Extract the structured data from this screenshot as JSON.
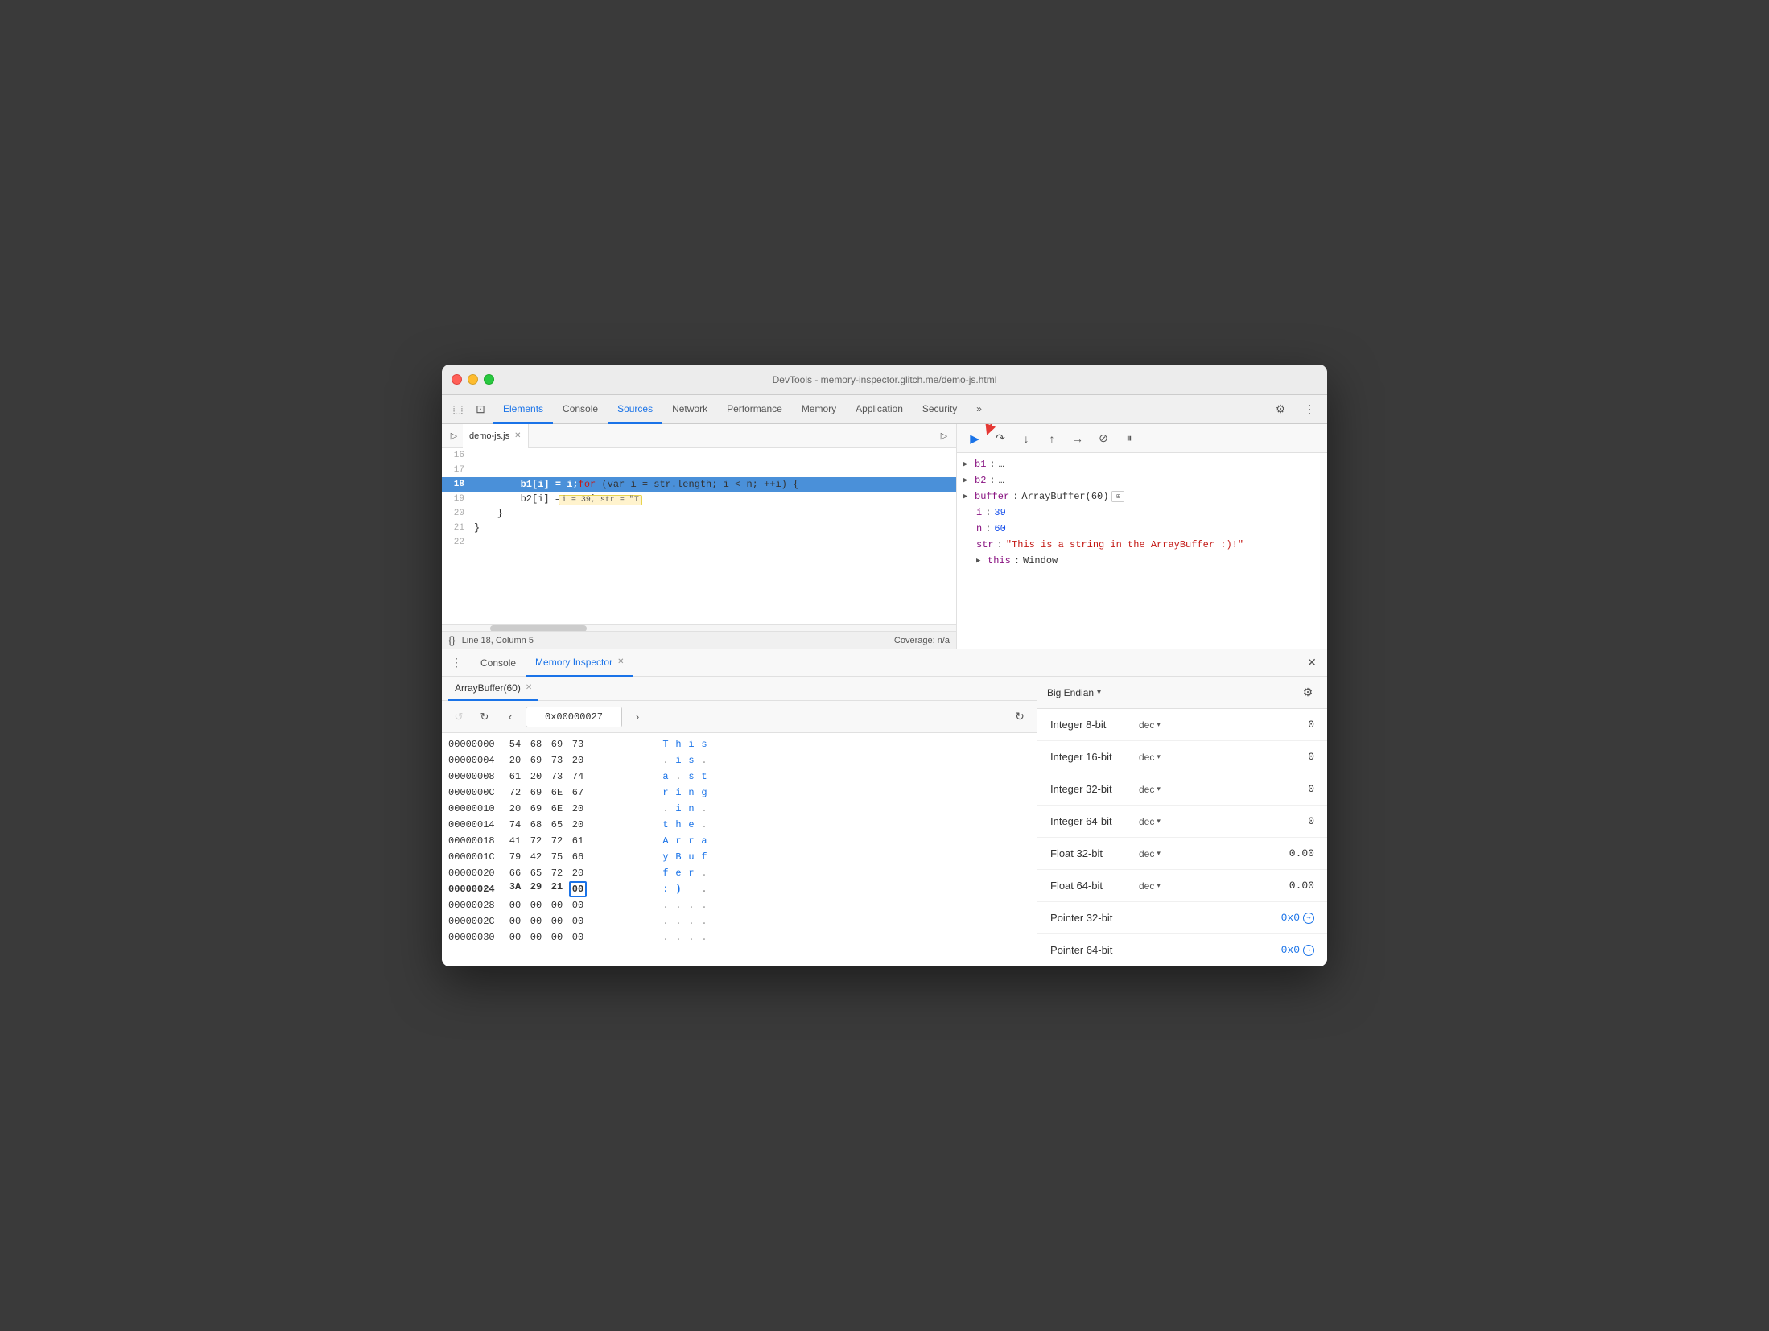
{
  "window": {
    "title": "DevTools - memory-inspector.glitch.me/demo-js.html"
  },
  "devtools_tabs": {
    "items": [
      {
        "id": "elements",
        "label": "Elements",
        "active": false
      },
      {
        "id": "console",
        "label": "Console",
        "active": false
      },
      {
        "id": "sources",
        "label": "Sources",
        "active": true
      },
      {
        "id": "network",
        "label": "Network",
        "active": false
      },
      {
        "id": "performance",
        "label": "Performance",
        "active": false
      },
      {
        "id": "memory",
        "label": "Memory",
        "active": false
      },
      {
        "id": "application",
        "label": "Application",
        "active": false
      },
      {
        "id": "security",
        "label": "Security",
        "active": false
      }
    ]
  },
  "file_tab": {
    "name": "demo-js.js",
    "show_close": true
  },
  "code": {
    "lines": [
      {
        "num": "16",
        "content": ""
      },
      {
        "num": "17",
        "content": "    for (var i = str.length; i < n; ++i) {   i = 39, str = \"T",
        "annotation": "  i = 39, str = \"T"
      },
      {
        "num": "18",
        "content": "        b1[i] = i;",
        "highlighted": true
      },
      {
        "num": "19",
        "content": "        b2[i] = n - i - 1;"
      },
      {
        "num": "20",
        "content": "    }"
      },
      {
        "num": "21",
        "content": "}"
      },
      {
        "num": "22",
        "content": ""
      }
    ],
    "status": {
      "line_col": "Line 18, Column 5",
      "coverage": "Coverage: n/a"
    }
  },
  "debug_panel": {
    "variables": [
      {
        "name": "b1",
        "value": "…",
        "has_arrow": true
      },
      {
        "name": "b2",
        "value": "…",
        "has_arrow": true
      },
      {
        "name": "buffer",
        "value": "ArrayBuffer(60)",
        "has_memory_icon": true,
        "has_arrow": true
      },
      {
        "name": "i",
        "value": "39",
        "is_number": true,
        "indent": true
      },
      {
        "name": "n",
        "value": "60",
        "is_number": true,
        "indent": true
      },
      {
        "name": "str",
        "value": "\"This is a string in the ArrayBuffer :)!\"",
        "is_string": true,
        "indent": true
      },
      {
        "name": "this",
        "value": "Window",
        "has_arrow": true,
        "indent": true
      }
    ]
  },
  "bottom_panel": {
    "tabs": [
      {
        "id": "console",
        "label": "Console",
        "active": false
      },
      {
        "id": "memory-inspector",
        "label": "Memory Inspector",
        "active": true,
        "closeable": true
      }
    ]
  },
  "memory_buffer_tab": {
    "name": "ArrayBuffer(60)",
    "closeable": true
  },
  "memory_toolbar": {
    "address": "0x00000027",
    "back_disabled": true,
    "forward_disabled": false
  },
  "endian": {
    "label": "Big Endian"
  },
  "hex_rows": [
    {
      "addr": "00000000",
      "bytes": [
        "54",
        "68",
        "69",
        "73"
      ],
      "chars": [
        "T",
        "h",
        "i",
        "s"
      ],
      "chars_dot": [
        false,
        false,
        false,
        false
      ]
    },
    {
      "addr": "00000004",
      "bytes": [
        "20",
        "69",
        "73",
        "20"
      ],
      "chars": [
        " ",
        "i",
        "s",
        " "
      ],
      "chars_dot": [
        true,
        false,
        false,
        true
      ]
    },
    {
      "addr": "00000008",
      "bytes": [
        "61",
        "20",
        "73",
        "74"
      ],
      "chars": [
        "a",
        " ",
        "s",
        "t"
      ],
      "chars_dot": [
        false,
        true,
        false,
        false
      ]
    },
    {
      "addr": "0000000C",
      "bytes": [
        "72",
        "69",
        "6E",
        "67"
      ],
      "chars": [
        "r",
        "i",
        "n",
        "g"
      ],
      "chars_dot": [
        false,
        false,
        false,
        false
      ]
    },
    {
      "addr": "00000010",
      "bytes": [
        "20",
        "69",
        "6E",
        "20"
      ],
      "chars": [
        " ",
        "i",
        "n",
        " "
      ],
      "chars_dot": [
        true,
        false,
        false,
        true
      ]
    },
    {
      "addr": "00000014",
      "bytes": [
        "74",
        "68",
        "65",
        "20"
      ],
      "chars": [
        "t",
        "h",
        "e",
        " "
      ],
      "chars_dot": [
        false,
        false,
        false,
        true
      ]
    },
    {
      "addr": "00000018",
      "bytes": [
        "41",
        "72",
        "72",
        "61"
      ],
      "chars": [
        "A",
        "r",
        "r",
        "a"
      ],
      "chars_dot": [
        false,
        false,
        false,
        false
      ]
    },
    {
      "addr": "0000001C",
      "bytes": [
        "79",
        "42",
        "75",
        "66"
      ],
      "chars": [
        "y",
        "B",
        "u",
        "f"
      ],
      "chars_dot": [
        false,
        false,
        false,
        false
      ]
    },
    {
      "addr": "00000020",
      "bytes": [
        "66",
        "65",
        "72",
        "20"
      ],
      "chars": [
        "f",
        "e",
        "r",
        " "
      ],
      "chars_dot": [
        false,
        false,
        false,
        true
      ]
    },
    {
      "addr": "00000024",
      "bytes": [
        "3A",
        "29",
        "21",
        "00"
      ],
      "chars": [
        ":",
        ")",
        " ",
        "."
      ],
      "chars_dot": [
        false,
        false,
        false,
        true
      ],
      "highlighted": true,
      "selected_byte_idx": 3
    },
    {
      "addr": "00000028",
      "bytes": [
        "00",
        "00",
        "00",
        "00"
      ],
      "chars": [
        ".",
        ".",
        ".",
        "."
      ],
      "chars_dot": [
        true,
        true,
        true,
        true
      ]
    },
    {
      "addr": "0000002C",
      "bytes": [
        "00",
        "00",
        "00",
        "00"
      ],
      "chars": [
        ".",
        ".",
        ".",
        "."
      ],
      "chars_dot": [
        true,
        true,
        true,
        true
      ]
    },
    {
      "addr": "00000030",
      "bytes": [
        "00",
        "00",
        "00",
        "00"
      ],
      "chars": [
        ".",
        ".",
        ".",
        "."
      ],
      "chars_dot": [
        true,
        true,
        true,
        true
      ]
    }
  ],
  "value_inspector": {
    "rows": [
      {
        "type": "Integer 8-bit",
        "format": "dec",
        "value": "0",
        "is_link": false
      },
      {
        "type": "Integer 16-bit",
        "format": "dec",
        "value": "0",
        "is_link": false
      },
      {
        "type": "Integer 32-bit",
        "format": "dec",
        "value": "0",
        "is_link": false
      },
      {
        "type": "Integer 64-bit",
        "format": "dec",
        "value": "0",
        "is_link": false
      },
      {
        "type": "Float 32-bit",
        "format": "dec",
        "value": "0.00",
        "is_link": false
      },
      {
        "type": "Float 64-bit",
        "format": "dec",
        "value": "0.00",
        "is_link": false
      },
      {
        "type": "Pointer 32-bit",
        "format": "",
        "value": "0x0",
        "is_link": true
      },
      {
        "type": "Pointer 64-bit",
        "format": "",
        "value": "0x0",
        "is_link": true
      }
    ]
  }
}
